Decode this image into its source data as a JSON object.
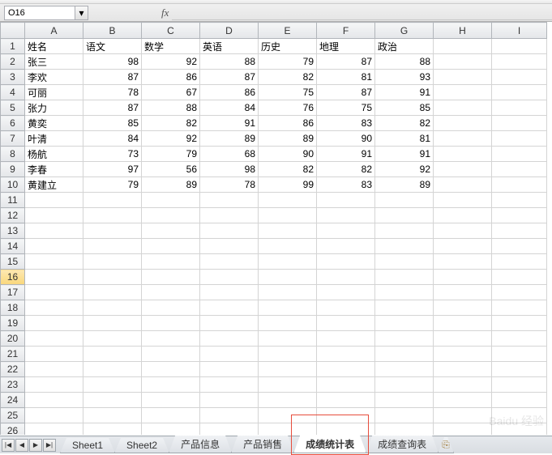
{
  "namebox": {
    "value": "O16"
  },
  "fx": {
    "label": "fx"
  },
  "columns": [
    "A",
    "B",
    "C",
    "D",
    "E",
    "F",
    "G",
    "H",
    "I"
  ],
  "row_count": 27,
  "selected_row": 16,
  "headers": [
    "姓名",
    "语文",
    "数学",
    "英语",
    "历史",
    "地理",
    "政治"
  ],
  "data_rows": [
    {
      "name": "张三",
      "scores": [
        98,
        92,
        88,
        79,
        87,
        88
      ]
    },
    {
      "name": "李欢",
      "scores": [
        87,
        86,
        87,
        82,
        81,
        93
      ]
    },
    {
      "name": "可丽",
      "scores": [
        78,
        67,
        86,
        75,
        87,
        91
      ]
    },
    {
      "name": "张力",
      "scores": [
        87,
        88,
        84,
        76,
        75,
        85
      ]
    },
    {
      "name": "黄奕",
      "scores": [
        85,
        82,
        91,
        86,
        83,
        82
      ]
    },
    {
      "name": "叶清",
      "scores": [
        84,
        92,
        89,
        89,
        90,
        81
      ]
    },
    {
      "name": "杨航",
      "scores": [
        73,
        79,
        68,
        90,
        91,
        91
      ]
    },
    {
      "name": "李春",
      "scores": [
        97,
        56,
        98,
        82,
        82,
        92
      ]
    },
    {
      "name": "黄建立",
      "scores": [
        79,
        89,
        78,
        99,
        83,
        89
      ]
    }
  ],
  "nav": {
    "first": "|◀",
    "prev": "◀",
    "next": "▶",
    "last": "▶|"
  },
  "sheet_tabs": [
    {
      "label": "Sheet1",
      "active": false
    },
    {
      "label": "Sheet2",
      "active": false
    },
    {
      "label": "产品信息",
      "active": false
    },
    {
      "label": "产品销售",
      "active": false
    },
    {
      "label": "成绩统计表",
      "active": true,
      "highlighted": true
    },
    {
      "label": "成绩查询表",
      "active": false
    }
  ],
  "newtab_icon": "⎘",
  "watermark": "Baidu 经验"
}
